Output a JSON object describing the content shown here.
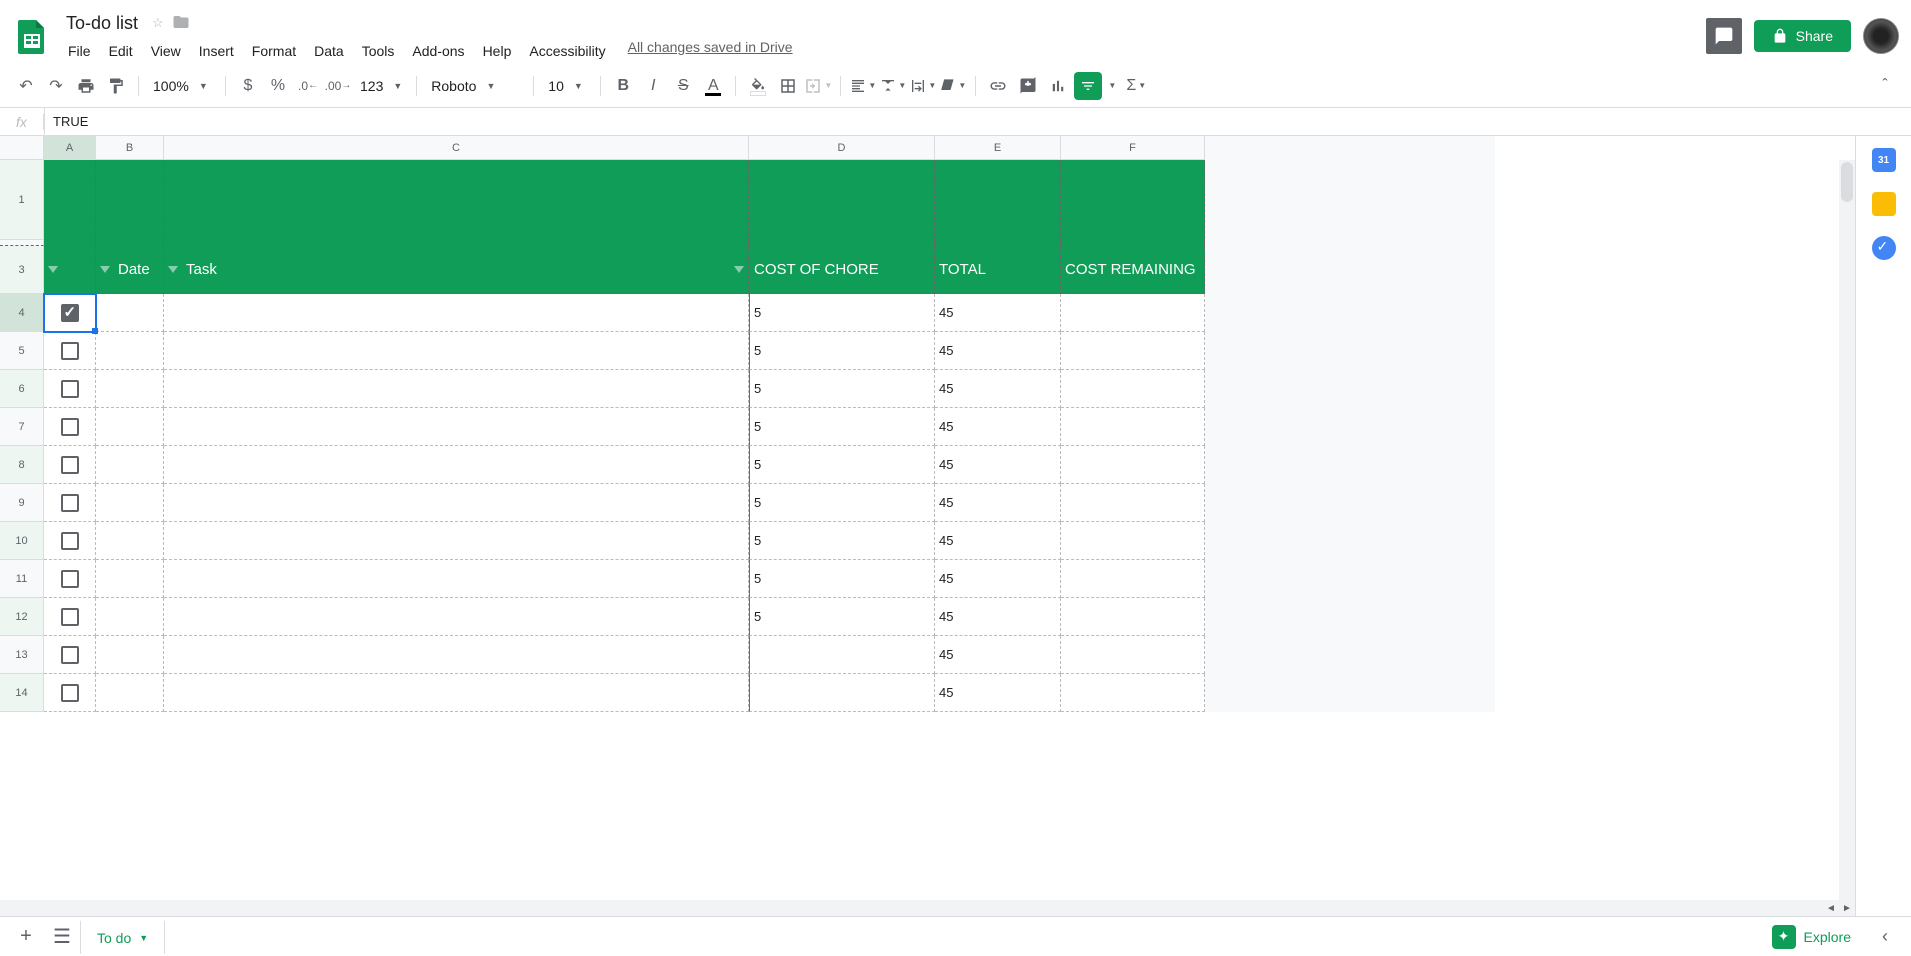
{
  "doc": {
    "title": "To-do list",
    "saved": "All changes saved in Drive"
  },
  "menus": [
    "File",
    "Edit",
    "View",
    "Insert",
    "Format",
    "Data",
    "Tools",
    "Add-ons",
    "Help",
    "Accessibility"
  ],
  "share": "Share",
  "toolbar": {
    "zoom": "100%",
    "font": "Roboto",
    "size": "10",
    "more": "123"
  },
  "formula": {
    "value": "TRUE"
  },
  "columns": [
    "A",
    "B",
    "C",
    "D",
    "E",
    "F"
  ],
  "headers": {
    "date": "Date",
    "task": "Task",
    "cost": "COST OF CHORE",
    "total": "TOTAL",
    "remaining": "COST REMAINING"
  },
  "rows": [
    {
      "n": "4",
      "checked": true,
      "cost": "5",
      "total": "45",
      "sel": true
    },
    {
      "n": "5",
      "checked": false,
      "cost": "5",
      "total": "45"
    },
    {
      "n": "6",
      "checked": false,
      "cost": "5",
      "total": "45"
    },
    {
      "n": "7",
      "checked": false,
      "cost": "5",
      "total": "45"
    },
    {
      "n": "8",
      "checked": false,
      "cost": "5",
      "total": "45"
    },
    {
      "n": "9",
      "checked": false,
      "cost": "5",
      "total": "45"
    },
    {
      "n": "10",
      "checked": false,
      "cost": "5",
      "total": "45"
    },
    {
      "n": "11",
      "checked": false,
      "cost": "5",
      "total": "45"
    },
    {
      "n": "12",
      "checked": false,
      "cost": "5",
      "total": "45"
    },
    {
      "n": "13",
      "checked": false,
      "cost": "",
      "total": "45"
    },
    {
      "n": "14",
      "checked": false,
      "cost": "",
      "total": "45"
    }
  ],
  "row_labels": {
    "r1": "1",
    "r3": "3"
  },
  "sheet": {
    "name": "To do"
  },
  "explore": "Explore",
  "calendar_day": "31"
}
